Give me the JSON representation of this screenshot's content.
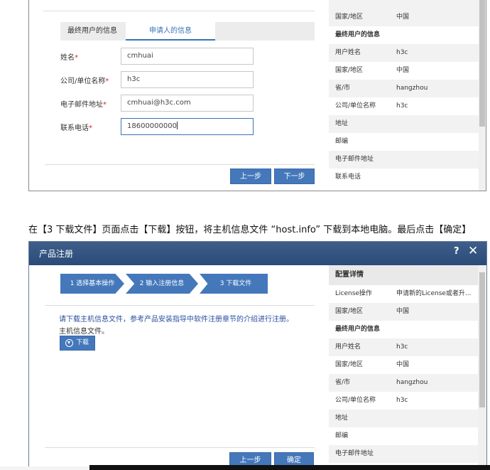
{
  "top_form": {
    "tabs": [
      "最终用户的信息",
      "申请人的信息"
    ],
    "fields": [
      {
        "label": "姓名",
        "required": "*",
        "value": "cmhuai"
      },
      {
        "label": "公司/单位名称",
        "required": "*",
        "value": "h3c"
      },
      {
        "label": "电子邮件地址",
        "required": "*",
        "value": "cmhuai@h3c.com"
      },
      {
        "label": "联系电话",
        "required": "*",
        "value": "18600000000"
      }
    ],
    "prev_label": "上一步",
    "next_label": "下一步",
    "side_rows": [
      {
        "k": "国家/地区",
        "v": "中国"
      },
      {
        "k": "最终用户的信息",
        "v": ""
      },
      {
        "k": "用户姓名",
        "v": "h3c"
      },
      {
        "k": "国家/地区",
        "v": "中国"
      },
      {
        "k": "省/市",
        "v": "hangzhou"
      },
      {
        "k": "公司/单位名称",
        "v": "h3c"
      },
      {
        "k": "地址",
        "v": ""
      },
      {
        "k": "邮编",
        "v": ""
      },
      {
        "k": "电子邮件地址",
        "v": ""
      },
      {
        "k": "联系电话",
        "v": ""
      }
    ]
  },
  "caption": "在【3 下载文件】页面点击【下载】按钮，将主机信息文件 “host.info” 下载到本地电脑。最后点击【确定】",
  "dialog": {
    "title": "产品注册",
    "help_glyph": "?",
    "close_glyph": "✕",
    "steps": [
      "1 选择基本操作",
      "2 输入注册信息",
      "3 下载文件"
    ],
    "notice": "请下载主机信息文件，参考产品安装指导中软件注册章节的介绍进行注册。",
    "host_label": "主机信息文件。",
    "download_label": "下载",
    "prev_label": "上一步",
    "confirm_label": "确定",
    "side_title": "配置详情",
    "side_rows": [
      {
        "k": "License操作",
        "v": "申请新的License或者升..."
      },
      {
        "k": "国家/地区",
        "v": "中国"
      },
      {
        "k": "最终用户的信息",
        "v": ""
      },
      {
        "k": "用户姓名",
        "v": "h3c"
      },
      {
        "k": "国家/地区",
        "v": "中国"
      },
      {
        "k": "省/市",
        "v": "hangzhou"
      },
      {
        "k": "公司/单位名称",
        "v": "h3c"
      },
      {
        "k": "地址",
        "v": ""
      },
      {
        "k": "邮编",
        "v": ""
      },
      {
        "k": "电子邮件地址",
        "v": ""
      }
    ]
  },
  "colors": {
    "accent": "#4478bb",
    "header": "#2f4f7f",
    "link": "#2a4fa0",
    "required": "#d22222"
  }
}
